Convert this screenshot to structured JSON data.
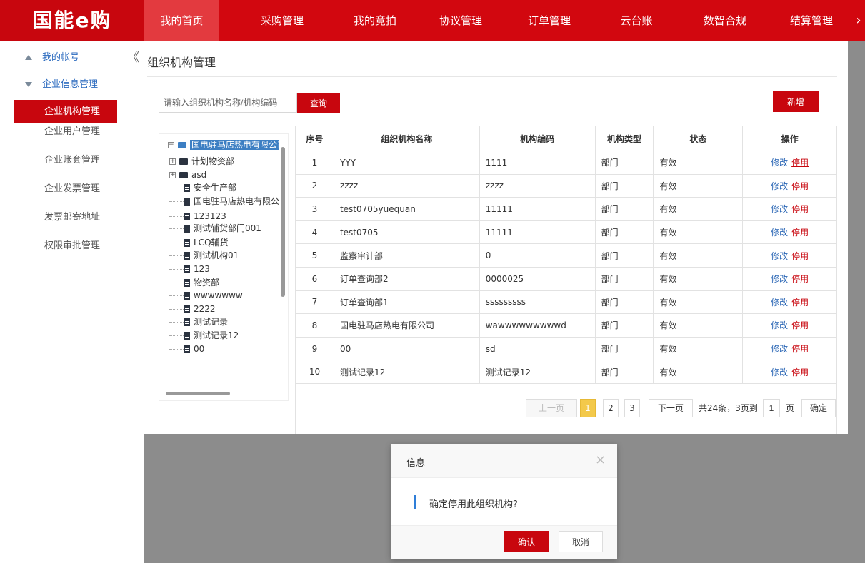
{
  "brand": {
    "logo": "国能e购"
  },
  "nav": {
    "items": [
      "我的首页",
      "采购管理",
      "我的竞拍",
      "协议管理",
      "订单管理",
      "云台账",
      "数智合规",
      "结算管理"
    ],
    "more": "›"
  },
  "sidebar": {
    "account_group": "我的帐号",
    "company_group": "企业信息管理",
    "collapse": "《",
    "items": [
      "企业机构管理",
      "企业用户管理",
      "企业账套管理",
      "企业发票管理",
      "发票邮寄地址",
      "权限审批管理"
    ]
  },
  "page": {
    "title": "组织机构管理"
  },
  "search": {
    "placeholder": "请输入组织机构名称/机构编码",
    "button": "查询"
  },
  "add_button": "新增",
  "tree": {
    "root": "国电驻马店热电有限公司",
    "nodes": [
      {
        "label": "计划物资部",
        "type": "folder"
      },
      {
        "label": "asd",
        "type": "folder"
      },
      {
        "label": "安全生产部",
        "type": "doc"
      },
      {
        "label": "国电驻马店热电有限公",
        "type": "doc"
      },
      {
        "label": "123123",
        "type": "doc"
      },
      {
        "label": "测试辅货部门001",
        "type": "doc"
      },
      {
        "label": "LCQ辅货",
        "type": "doc"
      },
      {
        "label": "测试机构01",
        "type": "doc"
      },
      {
        "label": "123",
        "type": "doc"
      },
      {
        "label": "物资部",
        "type": "doc"
      },
      {
        "label": "wwwwwww",
        "type": "doc"
      },
      {
        "label": "2222",
        "type": "doc"
      },
      {
        "label": "测试记录",
        "type": "doc"
      },
      {
        "label": "测试记录12",
        "type": "doc"
      },
      {
        "label": "00",
        "type": "doc"
      }
    ]
  },
  "table": {
    "headers": [
      "序号",
      "组织机构名称",
      "机构编码",
      "机构类型",
      "状态",
      "操作"
    ],
    "edit_label": "修改",
    "stop_label": "停用",
    "rows": [
      [
        "1",
        "YYY",
        "1111",
        "部门",
        "有效"
      ],
      [
        "2",
        "zzzz",
        "zzzz",
        "部门",
        "有效"
      ],
      [
        "3",
        "test0705yuequan",
        "11111",
        "部门",
        "有效"
      ],
      [
        "4",
        "test0705",
        "11111",
        "部门",
        "有效"
      ],
      [
        "5",
        "监察审计部",
        "0",
        "部门",
        "有效"
      ],
      [
        "6",
        "订单查询部2",
        "0000025",
        "部门",
        "有效"
      ],
      [
        "7",
        "订单查询部1",
        "sssssssss",
        "部门",
        "有效"
      ],
      [
        "8",
        "国电驻马店热电有限公司",
        "wawwwwwwwwwd",
        "部门",
        "有效"
      ],
      [
        "9",
        "00",
        "sd",
        "部门",
        "有效"
      ],
      [
        "10",
        "测试记录12",
        "测试记录12",
        "部门",
        "有效"
      ]
    ]
  },
  "pagination": {
    "prev": "上一页",
    "pages": [
      "1",
      "2",
      "3"
    ],
    "current": "1",
    "next": "下一页",
    "total": "共24条，3页到",
    "input_value": "1",
    "unit": "页",
    "confirm": "确定"
  },
  "dialog": {
    "title": "信息",
    "close": "×",
    "message": "确定停用此组织机构?",
    "ok": "确认",
    "cancel": "取消"
  },
  "colors": {
    "brand_red": "#d2070f",
    "link_blue": "#2a66b5",
    "page_current": "#f3c94b"
  }
}
